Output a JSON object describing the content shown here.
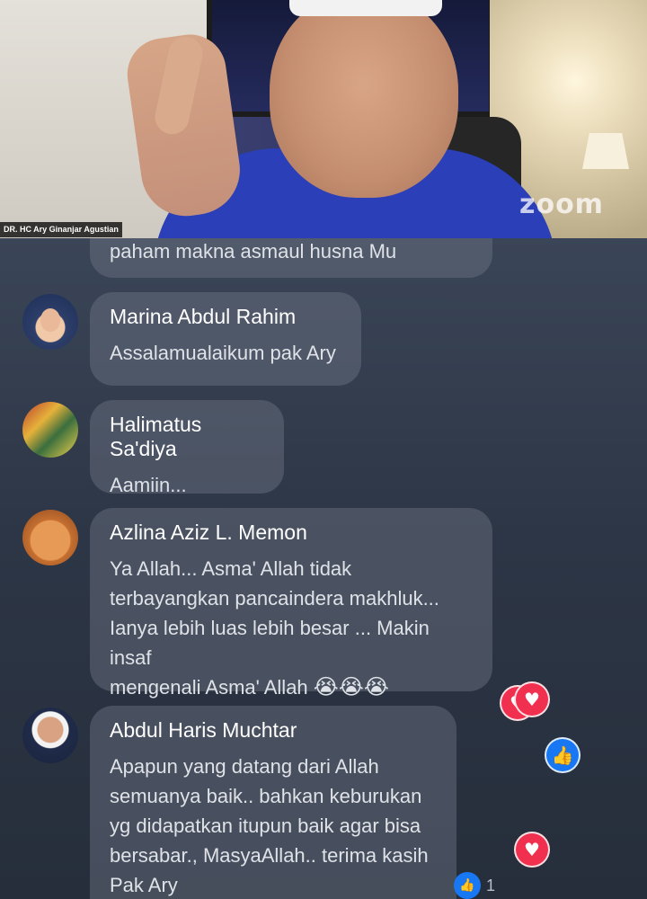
{
  "video": {
    "participant_name": "DR. HC Ary Ginanjar Agustian",
    "watermark": "zoom"
  },
  "partial_comment": {
    "text": "paham makna asmaul husna Mu"
  },
  "comments": [
    {
      "author": "Marina Abdul Rahim",
      "text": "Assalamualaikum pak Ary"
    },
    {
      "author": "Halimatus Sa'diya",
      "text": "Aamiin..."
    },
    {
      "author": "Azlina Aziz L. Memon",
      "lines": [
        "Ya Allah... Asma' Allah tidak",
        "terbayangkan pancaindera makhluk...",
        "Ianya lebih luas lebih besar ... Makin insaf",
        "mengenali Asma' Allah"
      ],
      "emoji": "😭😭😭"
    },
    {
      "author": "Abdul Haris Muchtar",
      "lines": [
        "Apapun yang datang dari Allah",
        "semuanya baik.. bahkan keburukan",
        "yg didapatkan itupun baik agar bisa",
        "bersabar., MasyaAllah.. terima kasih",
        "Pak Ary"
      ],
      "like_count": "1"
    }
  ],
  "reactions": [
    {
      "type": "heart-icon",
      "symbol": "♥"
    },
    {
      "type": "like-icon",
      "symbol": "👍"
    },
    {
      "type": "heart-icon",
      "symbol": "♥"
    }
  ],
  "colors": {
    "heart": "#f0304e",
    "like": "#1877f2"
  }
}
